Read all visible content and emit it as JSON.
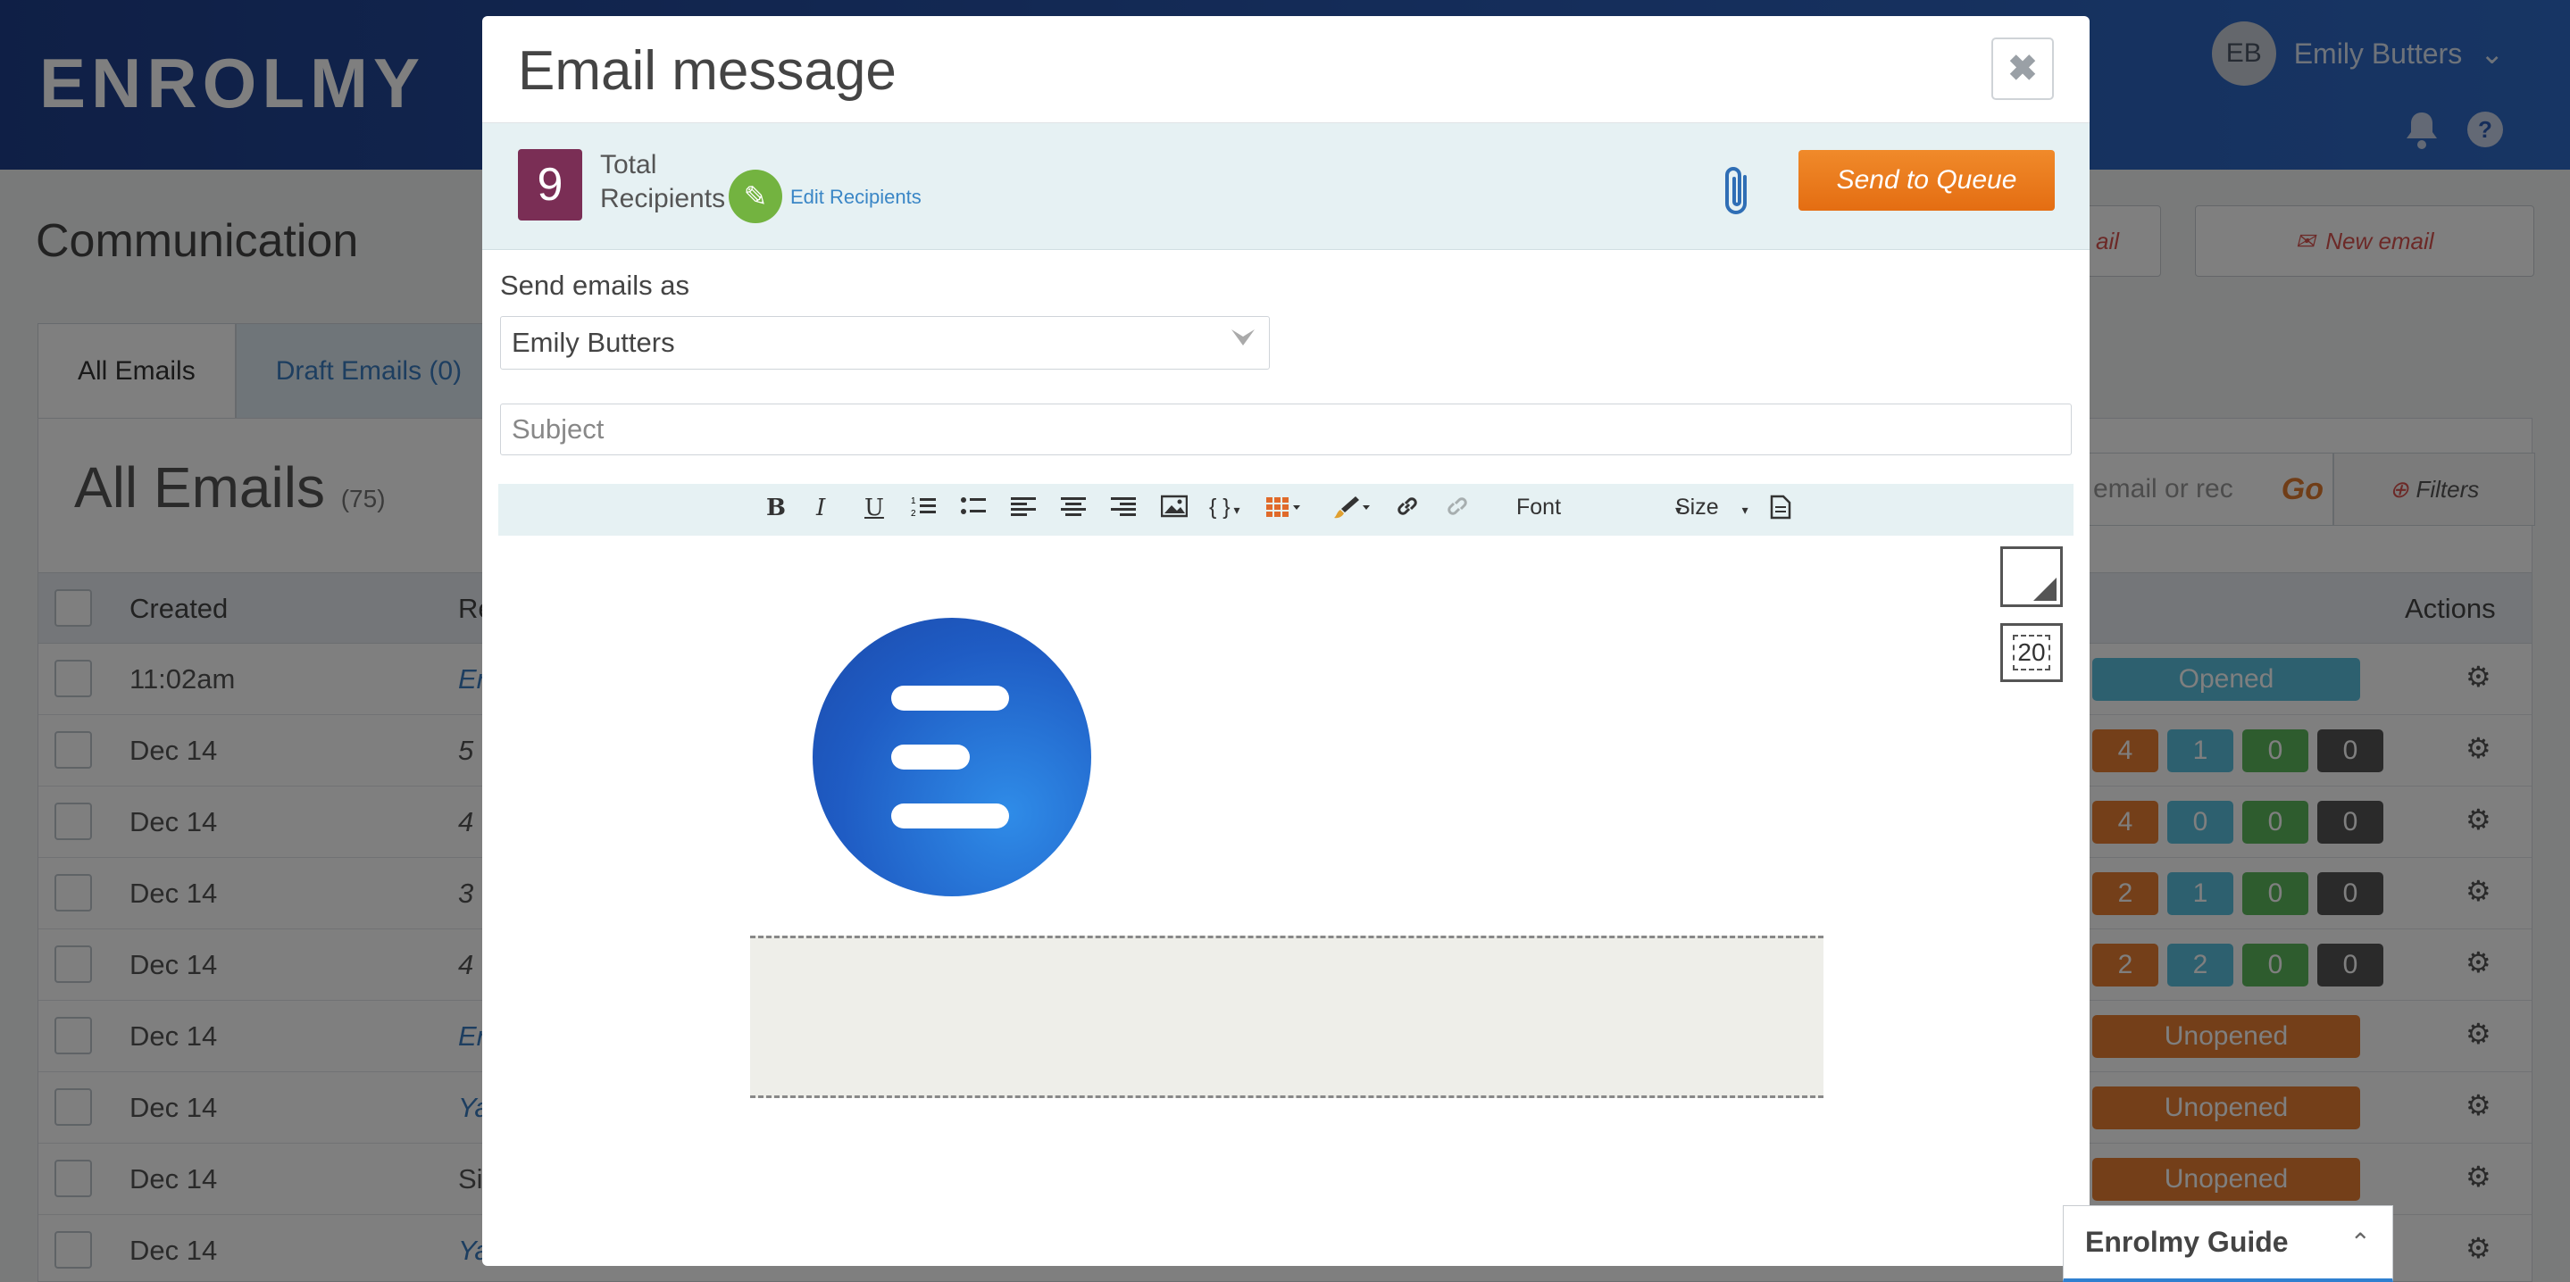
{
  "app": {
    "logo": "ENROLMY",
    "user": {
      "initials": "EB",
      "name": "Emily Butters",
      "caret": "⌄"
    },
    "bell_icon": "bell-icon",
    "help_icon": "help-icon"
  },
  "page": {
    "title": "Communication",
    "header_buttons": {
      "partial_label": "ail",
      "new_email_label": "New email"
    },
    "tabs": [
      {
        "label": "All Emails"
      },
      {
        "label": "Draft Emails (0)"
      }
    ],
    "list_title": "All Emails",
    "list_count": "(75)",
    "search_placeholder": "email or rec",
    "go_label": "Go",
    "filters_label": "Filters",
    "columns": {
      "created": "Created",
      "recipients_partial": "Re",
      "actions": "Actions"
    },
    "rows": [
      {
        "created": "11:02am",
        "recipient_fragment": "Er",
        "status": "Opened"
      },
      {
        "created": "Dec 14",
        "recipient_fragment": "5",
        "counts": [
          "4",
          "1",
          "0",
          "0"
        ]
      },
      {
        "created": "Dec 14",
        "recipient_fragment": "4",
        "counts": [
          "4",
          "0",
          "0",
          "0"
        ]
      },
      {
        "created": "Dec 14",
        "recipient_fragment": "3",
        "counts": [
          "2",
          "1",
          "0",
          "0"
        ]
      },
      {
        "created": "Dec 14",
        "recipient_fragment": "4",
        "counts": [
          "2",
          "2",
          "0",
          "0"
        ]
      },
      {
        "created": "Dec 14",
        "recipient_fragment": "Er",
        "status": "Unopened"
      },
      {
        "created": "Dec 14",
        "recipient_fragment": "Ya",
        "status": "Unopened"
      },
      {
        "created": "Dec 14",
        "recipient_fragment": "Si",
        "status": "Unopened"
      },
      {
        "created": "Dec 14",
        "recipient_fragment": "Ya"
      }
    ]
  },
  "modal": {
    "title": "Email message",
    "close_icon": "close-icon",
    "recipients": {
      "count": "9",
      "label_line1": "Total",
      "label_line2": "Recipients",
      "edit_label": "Edit Recipients",
      "edit_icon": "pencil-icon"
    },
    "attach_icon": "paperclip-icon",
    "send_button": "Send to Queue",
    "send_as_label": "Send emails as",
    "sender_value": "Emily Butters",
    "subject_placeholder": "Subject",
    "toolbar": {
      "bold": "B",
      "italic": "I",
      "underline": "U",
      "ordered_list_icon": "ordered-list-icon",
      "bullet_list_icon": "bullet-list-icon",
      "align_left_icon": "align-left-icon",
      "align_center_icon": "align-center-icon",
      "align_right_icon": "align-right-icon",
      "image_icon": "image-icon",
      "merge_fields_label": "{ }",
      "table_icon": "table-icon",
      "brush_icon": "brush-icon",
      "link_icon": "link-icon",
      "unlink_icon": "unlink-icon",
      "font_label": "Font",
      "size_label": "Size",
      "source_icon": "document-icon"
    },
    "side_controls": {
      "spacer_value": "20"
    }
  },
  "guide": {
    "title": "Enrolmy Guide",
    "caret": "⌃"
  },
  "colors": {
    "brand_blue": "#2a5bb5",
    "send_orange": "#e8751a",
    "recipients_badge": "#7a2e55",
    "edit_green": "#73b340",
    "opened": "#5bc0de",
    "unopened": "#e87f33"
  }
}
